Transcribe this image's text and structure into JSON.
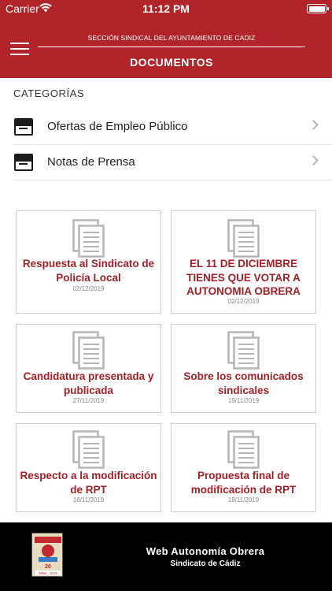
{
  "status_bar": {
    "carrier": "Carrier",
    "time": "11:12 PM"
  },
  "header": {
    "org_name": "SECCIÓN SINDICAL DEL AYUNTAMIENTO DE CADIZ",
    "title": "DOCUMENTOS",
    "background": "#b1252a"
  },
  "categories": {
    "heading": "CATEGORÍAS",
    "items": [
      {
        "label": "Ofertas de Empleo Público",
        "icon": "inbox-tray-icon"
      },
      {
        "label": "Notas de Prensa",
        "icon": "inbox-tray-icon"
      }
    ]
  },
  "documents": [
    {
      "title": "Respuesta al Sindicato de Policía Local",
      "date": "02/12/2019"
    },
    {
      "title": "EL 11 DE DICIEMBRE TIENES QUE VOTAR A AUTONOMIA OBRERA",
      "date": "02/12/2019"
    },
    {
      "title": "Candidatura presentada y publicada",
      "date": "27/11/2019"
    },
    {
      "title": "Sobre los comunicados sindicales",
      "date": "19/11/2019"
    },
    {
      "title": "Respecto a la modificación de RPT",
      "date": "18/11/2019"
    },
    {
      "title": "Propuesta final de modificación de RPT",
      "date": "18/11/2019"
    }
  ],
  "footer": {
    "title": "Web Autonomía Obrera",
    "subtitle": "Sindicato de Cádiz",
    "banner_text": "1996 · 2016"
  },
  "colors": {
    "accent": "#b1252a",
    "doc_title": "#a51f26",
    "footer_bg": "#000000"
  }
}
